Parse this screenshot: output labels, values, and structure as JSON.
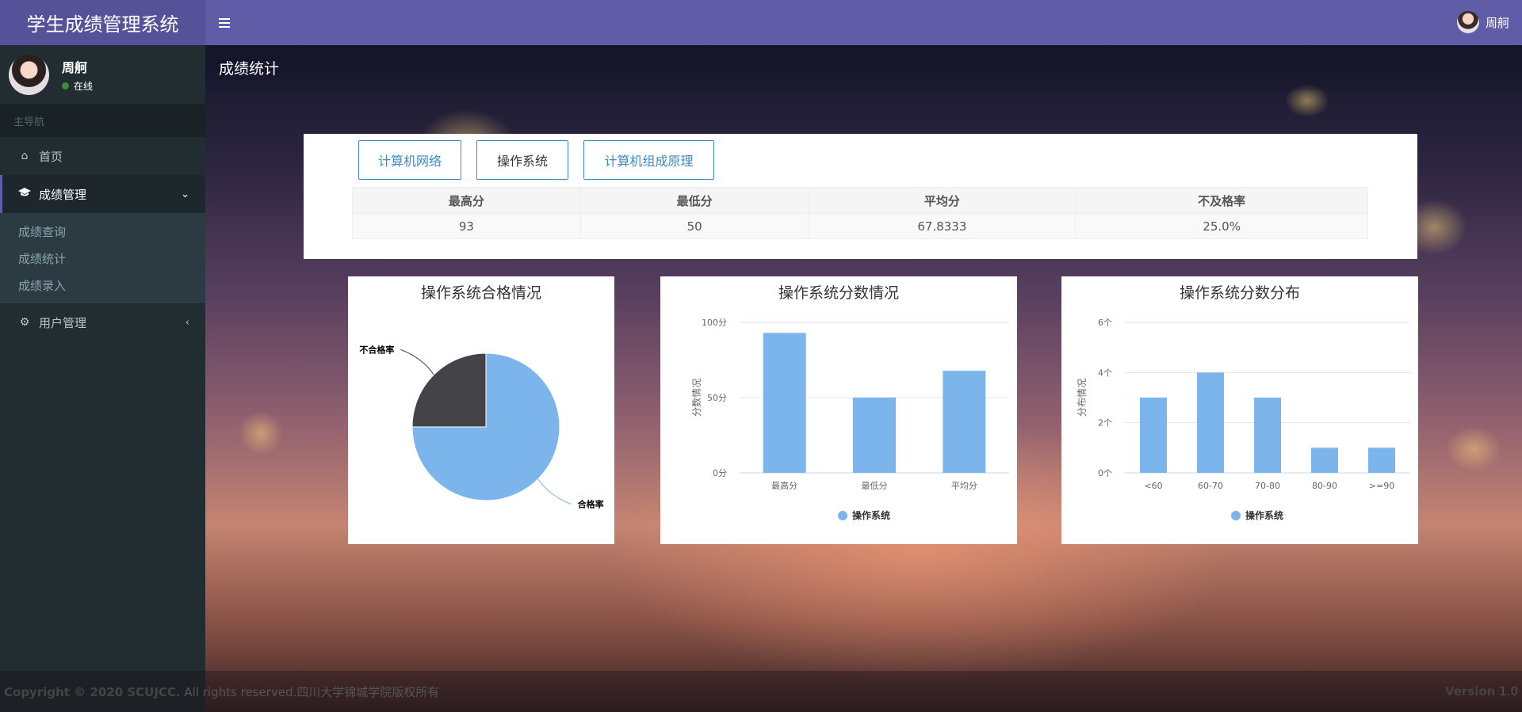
{
  "app": {
    "title": "学生成绩管理系统"
  },
  "header": {
    "user_name": "周舸"
  },
  "sidebar": {
    "user": {
      "name": "周舸",
      "status": "在线"
    },
    "section_label": "主导航",
    "items": [
      {
        "label": "首页",
        "icon": "home-icon"
      },
      {
        "label": "成绩管理",
        "icon": "graduation-cap-icon",
        "arrow": "chevron-down-icon"
      },
      {
        "label": "用户管理",
        "icon": "gear-icon",
        "arrow": "chevron-left-icon"
      }
    ],
    "subitems": [
      "成绩查询",
      "成绩统计",
      "成绩录入"
    ]
  },
  "page": {
    "title": "成绩统计"
  },
  "course_tabs": [
    "计算机网络",
    "操作系统",
    "计算机组成原理"
  ],
  "stats": {
    "headers": [
      "最高分",
      "最低分",
      "平均分",
      "不及格率"
    ],
    "values": [
      "93",
      "50",
      "67.8333",
      "25.0%"
    ]
  },
  "chart_data": [
    {
      "type": "pie",
      "title": "操作系统合格情况",
      "slices": [
        {
          "label": "合格率",
          "value": 75,
          "color": "#7cb5ec"
        },
        {
          "label": "不合格率",
          "value": 25,
          "color": "#434348"
        }
      ]
    },
    {
      "type": "bar",
      "title": "操作系统分数情况",
      "categories": [
        "最高分",
        "最低分",
        "平均分"
      ],
      "values": [
        93,
        50,
        67.8333
      ],
      "ylabel": "分数情况",
      "ylim": [
        0,
        100
      ],
      "yticks": [
        "0分",
        "50分",
        "100分"
      ],
      "legend": "操作系统",
      "color": "#7cb5ec"
    },
    {
      "type": "bar",
      "title": "操作系统分数分布",
      "categories": [
        "<60",
        "60-70",
        "70-80",
        "80-90",
        ">=90"
      ],
      "values": [
        3,
        4,
        3,
        1,
        1
      ],
      "ylabel": "分布情况",
      "ylim": [
        0,
        6
      ],
      "yticks": [
        "0个",
        "2个",
        "4个",
        "6个"
      ],
      "legend": "操作系统",
      "color": "#7cb5ec"
    }
  ],
  "footer": {
    "copyright_bold": "Copyright © 2020 SCUJCC.",
    "copyright_rest": " All rights reserved.四川大学锦城学院版权所有",
    "version_label": "Version",
    "version": "1.0"
  }
}
